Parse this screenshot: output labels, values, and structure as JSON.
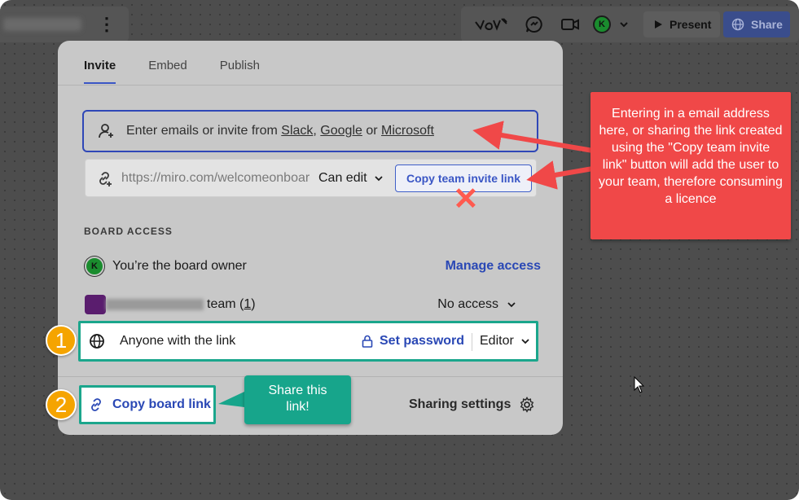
{
  "topbar": {
    "present_label": "Present",
    "share_label": "Share",
    "avatar_initial": "K"
  },
  "dialog": {
    "tabs": [
      "Invite",
      "Embed",
      "Publish"
    ],
    "invite_input": {
      "prefix": "Enter emails or invite from ",
      "slack": "Slack",
      "sep1": ", ",
      "google": "Google",
      "sep2": " or ",
      "microsoft": "Microsoft"
    },
    "link_row": {
      "url": "https://miro.com/welcomeonboard",
      "permission": "Can edit",
      "copy_team_label": "Copy team invite link"
    },
    "board_access": {
      "heading": "BOARD ACCESS",
      "owner_avatar_initial": "K",
      "owner_text": "You’re the board owner",
      "manage_access": "Manage access",
      "team_suffix": "team (",
      "team_count": "1",
      "team_close": ")",
      "team_access": "No access",
      "anyone_label": "Anyone with the link",
      "set_password": "Set password",
      "anyone_role": "Editor"
    },
    "footer": {
      "copy_board_link": "Copy board link",
      "sharing_settings": "Sharing settings"
    }
  },
  "annotations": {
    "badge_1": "1",
    "badge_2": "2",
    "red_callout": "Entering in a email address here, or sharing the link created using the \"Copy team invite link\" button will add the user to your team, therefore consuming a licence",
    "green_callout_line1": "Share this",
    "green_callout_line2": "link!",
    "colors": {
      "red_callout": "#f04848",
      "green_callout": "#17a58b",
      "badge": "#f5a400",
      "accent_blue": "#2a48b5"
    }
  }
}
